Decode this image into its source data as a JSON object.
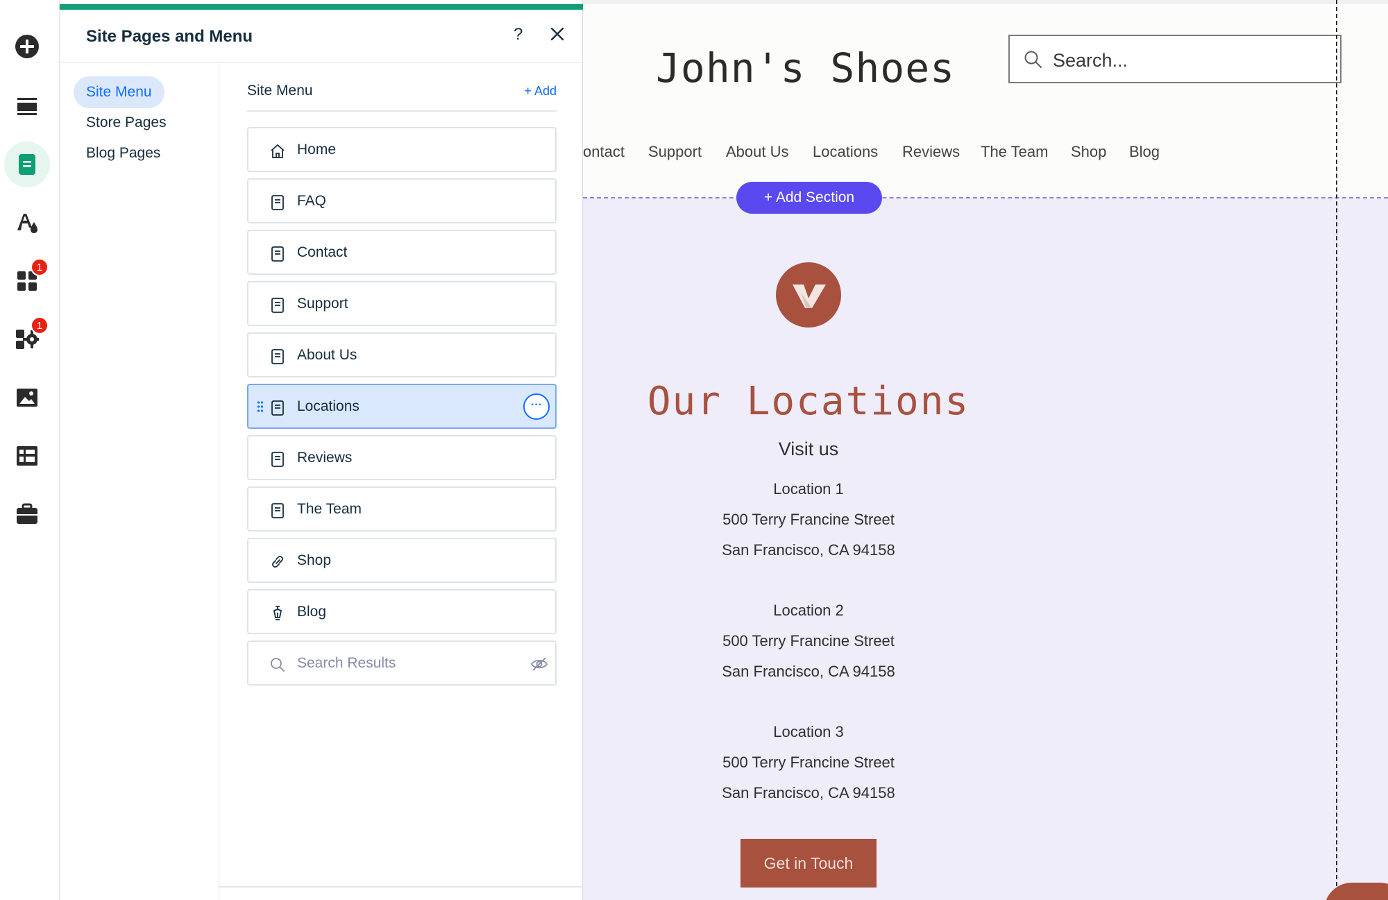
{
  "rail": {
    "items": [
      {
        "icon": "add-icon",
        "badge": ""
      },
      {
        "icon": "sections-icon",
        "badge": ""
      },
      {
        "icon": "pages-icon",
        "badge": ""
      },
      {
        "icon": "theme-icon",
        "badge": ""
      },
      {
        "icon": "apps-icon",
        "badge": "1"
      },
      {
        "icon": "business-apps-icon",
        "badge": "1"
      },
      {
        "icon": "media-icon",
        "badge": ""
      },
      {
        "icon": "cms-icon",
        "badge": ""
      },
      {
        "icon": "portfolio-icon",
        "badge": ""
      }
    ],
    "accent_color": "#0f9f74"
  },
  "panel": {
    "title": "Site Pages and Menu",
    "help": "?",
    "nav": [
      "Site Menu",
      "Store Pages",
      "Blog Pages"
    ],
    "menu_title": "Site Menu",
    "menu_add": "+ Add",
    "pages": [
      {
        "label": "Home",
        "icon": "home-icon"
      },
      {
        "label": "FAQ",
        "icon": "page-icon"
      },
      {
        "label": "Contact",
        "icon": "page-icon"
      },
      {
        "label": "Support",
        "icon": "page-icon"
      },
      {
        "label": "About Us",
        "icon": "page-icon"
      },
      {
        "label": "Locations",
        "icon": "page-icon",
        "selected": true
      },
      {
        "label": "Reviews",
        "icon": "page-icon"
      },
      {
        "label": "The Team",
        "icon": "page-icon"
      },
      {
        "label": "Shop",
        "icon": "link-icon"
      },
      {
        "label": "Blog",
        "icon": "pen-icon"
      },
      {
        "label": "Search Results",
        "icon": "search-icon",
        "hidden": true
      }
    ],
    "more_label": "···"
  },
  "site": {
    "title": "John's Shoes",
    "search_placeholder": "Search...",
    "nav": [
      "ontact",
      "Support",
      "About Us",
      "Locations",
      "Reviews",
      "The Team",
      "Shop",
      "Blog"
    ],
    "add_section": "+ Add Section",
    "section_title": "Our Locations",
    "visit": "Visit us",
    "locations": [
      {
        "name": "Location 1",
        "street": "500 Terry Francine Street",
        "city": "San Francisco, CA 94158"
      },
      {
        "name": "Location 2",
        "street": "500 Terry Francine Street",
        "city": "San Francisco, CA 94158"
      },
      {
        "name": "Location 3",
        "street": "500 Terry Francine Street",
        "city": "San Francisco, CA 94158"
      }
    ],
    "cta": "Get in Touch",
    "brand_color": "#a8513e",
    "add_section_color": "#5b49f0"
  }
}
